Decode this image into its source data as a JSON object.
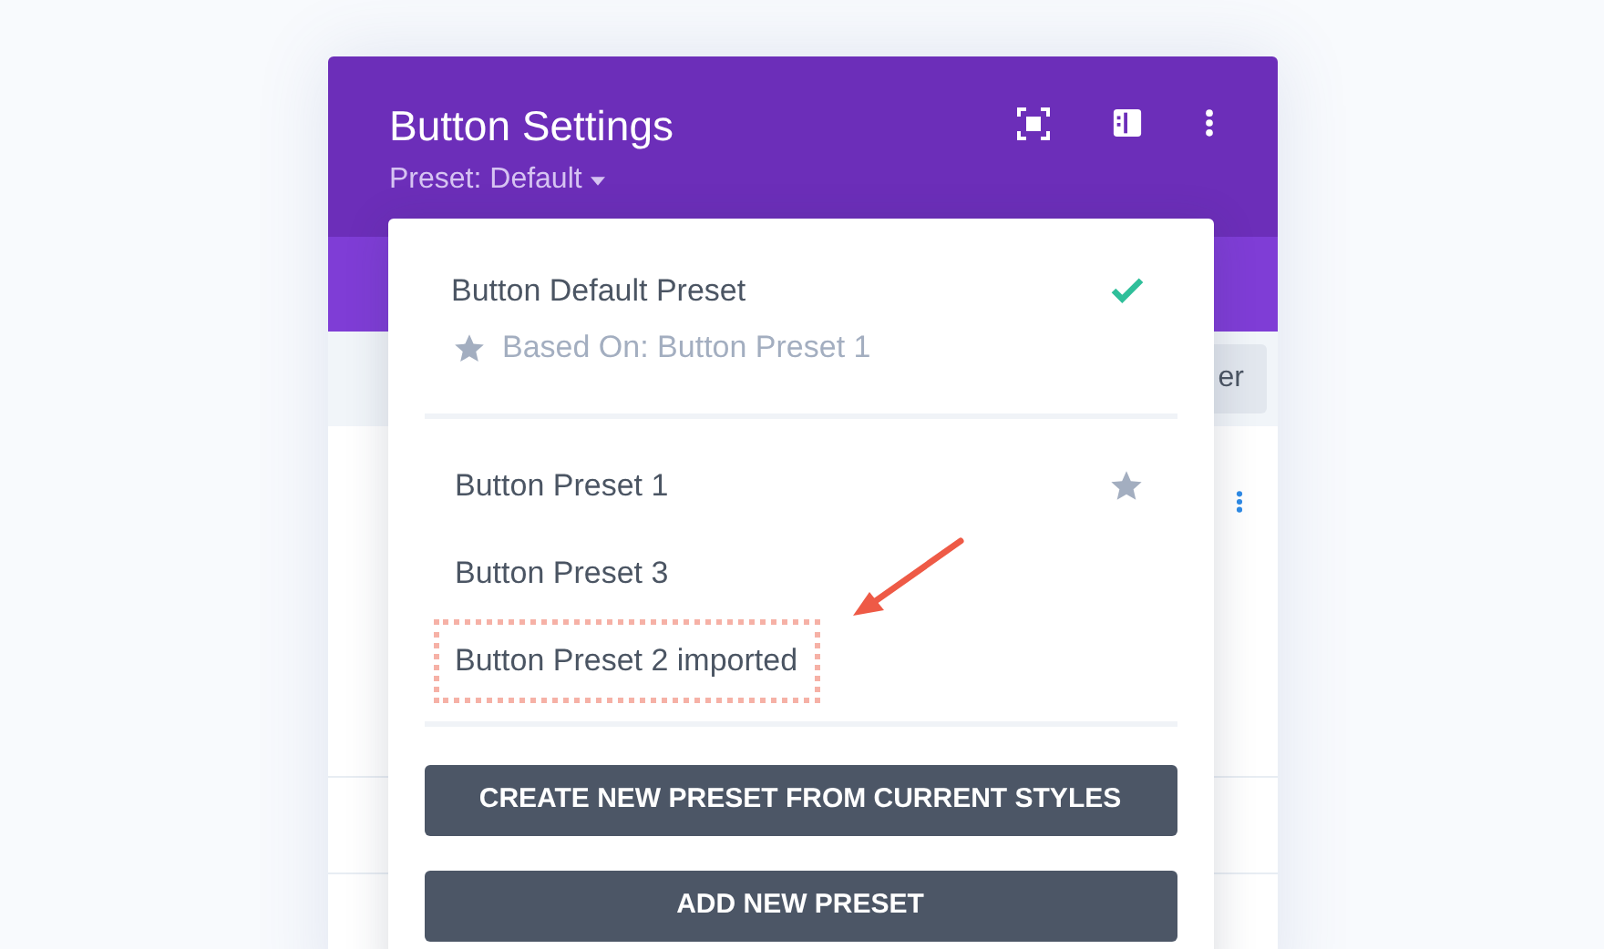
{
  "header": {
    "title": "Button Settings",
    "preset_label": "Preset: Default"
  },
  "background": {
    "partial_button": "er"
  },
  "dropdown": {
    "current": {
      "name": "Button Default Preset",
      "selected": true,
      "based_on": "Based On: Button Preset 1"
    },
    "presets": [
      {
        "name": "Button Preset 1",
        "starred": true,
        "highlighted": false
      },
      {
        "name": "Button Preset 3",
        "starred": false,
        "highlighted": false
      },
      {
        "name": "Button Preset 2 imported",
        "starred": false,
        "highlighted": true
      }
    ],
    "buttons": [
      "CREATE NEW PRESET FROM CURRENT STYLES",
      "ADD NEW PRESET"
    ]
  }
}
